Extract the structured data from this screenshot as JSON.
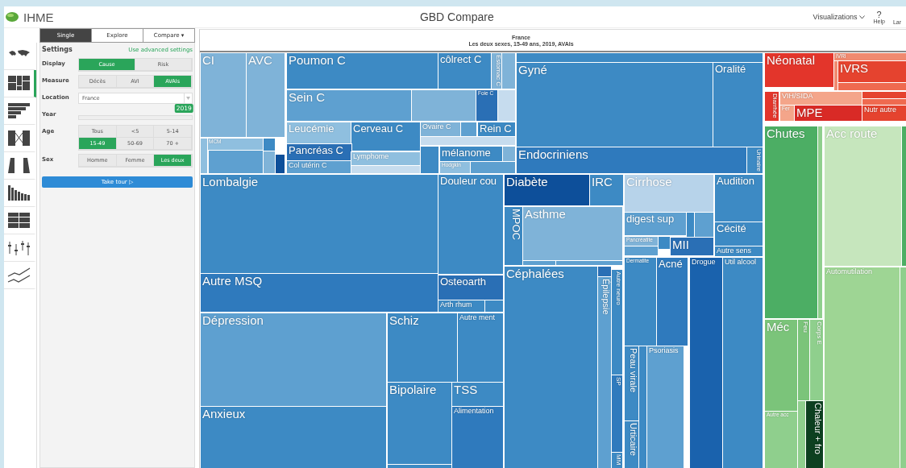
{
  "header": {
    "logo": "IHME",
    "title": "GBD Compare",
    "menu": "Visualizations",
    "help_icon": "?",
    "help": "Help",
    "language": "Lar"
  },
  "viz_icons": [
    {
      "kind": "map",
      "selected": false
    },
    {
      "kind": "treemap",
      "selected": true
    },
    {
      "kind": "stacked",
      "selected": false
    },
    {
      "kind": "arrows",
      "selected": false
    },
    {
      "kind": "pyramid",
      "selected": false
    },
    {
      "kind": "ranked",
      "selected": false
    },
    {
      "kind": "grid",
      "selected": false
    },
    {
      "kind": "whisker",
      "selected": false
    },
    {
      "kind": "line",
      "selected": false
    }
  ],
  "mode_tabs": [
    {
      "label": "Single",
      "selected": true
    },
    {
      "label": "Explore",
      "selected": false
    },
    {
      "label": "Compare ▾",
      "selected": false
    }
  ],
  "settings": {
    "title": "Settings",
    "advanced_link": "Use advanced settings",
    "display": {
      "label": "Display",
      "options": [
        {
          "label": "Cause",
          "selected": true
        },
        {
          "label": "Risk",
          "selected": false
        }
      ]
    },
    "measure": {
      "label": "Measure",
      "options": [
        {
          "label": "Décès",
          "selected": false
        },
        {
          "label": "AVI",
          "selected": false
        },
        {
          "label": "AVAIs",
          "selected": true
        }
      ]
    },
    "location": {
      "label": "Location",
      "value": "France"
    },
    "year": {
      "label": "Year",
      "value": "2019",
      "level": 1.0
    },
    "age": {
      "label": "Age",
      "options": [
        {
          "label": "Tous",
          "selected": false
        },
        {
          "label": "<5",
          "selected": false
        },
        {
          "label": "5-14",
          "selected": false
        },
        {
          "label": "15-49",
          "selected": true
        },
        {
          "label": "50-69",
          "selected": false
        },
        {
          "label": "70 +",
          "selected": false
        }
      ]
    },
    "sex": {
      "label": "Sex",
      "options": [
        {
          "label": "Homme",
          "selected": false
        },
        {
          "label": "Femme",
          "selected": false
        },
        {
          "label": "Les deux",
          "selected": true
        }
      ]
    },
    "tour_button": "Take tour ▷"
  },
  "treemap": {
    "title": "France",
    "subtitle": "Les deux sexes, 15-49 ans, 2019, AVAIs",
    "tiles": [
      {
        "label": "CI",
        "color": "#7fb3d8",
        "kind": "large"
      },
      {
        "label": "AVC",
        "color": "#7fb3d8",
        "kind": "large"
      },
      {
        "label": "MCM",
        "color": "#8fbfdf",
        "kind": "tiny"
      },
      {
        "color": "#5ea0d0",
        "kind": "blank"
      },
      {
        "color": "#3d8ac4",
        "kind": "blank"
      },
      {
        "color": "#7fb3d8",
        "kind": "blank"
      },
      {
        "color": "#0d4f9a",
        "kind": "blank"
      },
      {
        "color": "#8fbfdf",
        "kind": "blank"
      },
      {
        "label": "Poumon C",
        "color": "#3d8ac4",
        "kind": "large"
      },
      {
        "label": "côlrect C",
        "color": "#3d8ac4",
        "kind": "medium"
      },
      {
        "label": "Estomac C",
        "color": "#7fb3d8",
        "kind": "v-tiny"
      },
      {
        "color": "#7fb3d8",
        "kind": "blank"
      },
      {
        "label": "Sein C",
        "color": "#5ea0d0",
        "kind": "large"
      },
      {
        "color": "#7fb3d8",
        "kind": "blank"
      },
      {
        "label": "Foie C",
        "color": "#2a6fb5",
        "kind": "tiny"
      },
      {
        "color": "#c6dcee",
        "kind": "blank"
      },
      {
        "label": "Leucémie",
        "color": "#8fbfdf",
        "kind": "medium"
      },
      {
        "label": "Cerveau C",
        "color": "#3d8ac4",
        "kind": "medium"
      },
      {
        "label": "Ovaire C",
        "color": "#7fb3d8",
        "kind": "small"
      },
      {
        "color": "#5ea0d0",
        "kind": "blank"
      },
      {
        "label": "Rein C",
        "color": "#3d8ac4",
        "kind": "medium"
      },
      {
        "label": "Pancréas C",
        "color": "#2a6fb5",
        "kind": "medium"
      },
      {
        "label": "Col utérin C",
        "color": "#5ea0d0",
        "kind": "small"
      },
      {
        "label": "Lymphome",
        "color": "#8fbfdf",
        "kind": "small"
      },
      {
        "color": "#c6dcee",
        "kind": "blank"
      },
      {
        "color": "#c6dcee",
        "kind": "blank"
      },
      {
        "color": "#3d8ac4",
        "kind": "blank"
      },
      {
        "label": "mélanome",
        "color": "#3d8ac4",
        "kind": "medium"
      },
      {
        "label": "Hodgkin",
        "color": "#8fbfdf",
        "kind": "tiny"
      },
      {
        "color": "#5ea0d0",
        "kind": "blank"
      },
      {
        "color": "#7fb3d8",
        "kind": "blank"
      },
      {
        "color": "#3d8ac4",
        "kind": "blank"
      },
      {
        "label": "Gyné",
        "color": "#3d8ac4",
        "kind": "large"
      },
      {
        "label": "Oralité",
        "color": "#3d8ac4",
        "kind": "medium"
      },
      {
        "label": "Endocriniens",
        "color": "#2f7abd",
        "kind": "large"
      },
      {
        "label": "Urinaire",
        "color": "#3d8ac4",
        "kind": "v-tiny"
      },
      {
        "label": "Lombalgie",
        "color": "#3d8ac4",
        "kind": "large"
      },
      {
        "label": "Douleur cou",
        "color": "#3d8ac4",
        "kind": "medium"
      },
      {
        "label": "Autre MSQ",
        "color": "#2f7abd",
        "kind": "large"
      },
      {
        "label": "Osteoarth",
        "color": "#2a6fb5",
        "kind": "medium"
      },
      {
        "label": "Arth rhum",
        "color": "#3d8ac4",
        "kind": "small"
      },
      {
        "color": "#3d8ac4",
        "kind": "blank"
      },
      {
        "label": "Dépression",
        "color": "#5ea0d0",
        "kind": "large"
      },
      {
        "label": "Anxieux",
        "color": "#3d8ac4",
        "kind": "large"
      },
      {
        "label": "Schiz",
        "color": "#3d8ac4",
        "kind": "large"
      },
      {
        "label": "Autre ment",
        "color": "#3d8ac4",
        "kind": "small"
      },
      {
        "label": "Bipolaire",
        "color": "#3d8ac4",
        "kind": "large"
      },
      {
        "color": "#3d8ac4",
        "kind": "blank"
      },
      {
        "label": "TSS",
        "color": "#3d8ac4",
        "kind": "large"
      },
      {
        "label": "Alimentation",
        "color": "#2f7abd",
        "kind": "small"
      },
      {
        "label": "Diabète",
        "color": "#0d4f9a",
        "kind": "large"
      },
      {
        "label": "IRC",
        "color": "#3d8ac4",
        "kind": "large"
      },
      {
        "label": "MPOC",
        "color": "#3d8ac4",
        "kind": "v-large"
      },
      {
        "label": "Asthme",
        "color": "#7fb3d8",
        "kind": "large"
      },
      {
        "color": "#5ea0d0",
        "kind": "blank"
      },
      {
        "color": "#5ea0d0",
        "kind": "blank"
      },
      {
        "label": "Céphalées",
        "color": "#3d8ac4",
        "kind": "large"
      },
      {
        "color": "#2a6fb5",
        "kind": "blank"
      },
      {
        "label": "Épilepsie",
        "color": "#5ea0d0",
        "kind": "v-medium"
      },
      {
        "label": "Autre neuro",
        "color": "#3d8ac4",
        "kind": "v-small"
      },
      {
        "label": "SP",
        "color": "#2f7abd",
        "kind": "v-small"
      },
      {
        "label": "MM",
        "color": "#3d8ac4",
        "kind": "v-tiny"
      },
      {
        "label": "Cirrhose",
        "color": "#b7d3ea",
        "kind": "large"
      },
      {
        "label": "digest sup",
        "color": "#5ea0d0",
        "kind": "medium"
      },
      {
        "color": "#3d8ac4",
        "kind": "blank"
      },
      {
        "color": "#5ea0d0",
        "kind": "blank"
      },
      {
        "label": "Pancréatite",
        "color": "#7fb3d8",
        "kind": "tiny"
      },
      {
        "color": "#3d8ac4",
        "kind": "blank"
      },
      {
        "label": "MII",
        "color": "#2a6fb5",
        "kind": "large"
      },
      {
        "color": "#5ea0d0",
        "kind": "blank"
      },
      {
        "label": "Audition",
        "color": "#3d8ac4",
        "kind": "medium"
      },
      {
        "label": "Cécité",
        "color": "#3d8ac4",
        "kind": "medium"
      },
      {
        "label": "Autre sens",
        "color": "#3d8ac4",
        "kind": "small"
      },
      {
        "label": "Dermatite",
        "color": "#3d8ac4",
        "kind": "tiny"
      },
      {
        "label": "Acné",
        "color": "#2f7abd",
        "kind": "medium"
      },
      {
        "label": "Peau virale",
        "color": "#3d8ac4",
        "kind": "v-medium"
      },
      {
        "label": "Urticaire",
        "color": "#3d8ac4",
        "kind": "v-medium"
      },
      {
        "color": "#3d8ac4",
        "kind": "blank"
      },
      {
        "label": "Psoriasis",
        "color": "#5ea0d0",
        "kind": "small"
      },
      {
        "label": "Drogue",
        "color": "#1a62ad",
        "kind": "small"
      },
      {
        "label": "Util alcool",
        "color": "#3d8ac4",
        "kind": "small"
      },
      {
        "label": "Néonatal",
        "color": "#e3352b",
        "kind": "large"
      },
      {
        "label": "IVRI",
        "color": "#f08a70",
        "kind": "tiny"
      },
      {
        "color": "#f08a70",
        "kind": "blank"
      },
      {
        "label": "IVRS",
        "color": "#e5432f",
        "kind": "large"
      },
      {
        "color": "#ef6a50",
        "kind": "blank"
      },
      {
        "label": "Diarrhée",
        "color": "#e3352b",
        "kind": "v-tiny"
      },
      {
        "label": "VIH/SIDA",
        "color": "#f4a58a",
        "kind": "small"
      },
      {
        "color": "#e5432f",
        "kind": "blank"
      },
      {
        "color": "#ef6a50",
        "kind": "blank"
      },
      {
        "label": "Fer",
        "color": "#f4a58a",
        "kind": "tiny"
      },
      {
        "label": "MPE",
        "color": "#d92a26",
        "kind": "large"
      },
      {
        "label": "Nutr autre",
        "color": "#e5432f",
        "kind": "small"
      },
      {
        "label": "Chutes",
        "color": "#4cae64",
        "kind": "large"
      },
      {
        "color": "#8fcf8d",
        "kind": "blank"
      },
      {
        "label": "Acc route",
        "color": "#c6e6bd",
        "kind": "large"
      },
      {
        "color": "#4cae64",
        "kind": "blank"
      },
      {
        "label": "Automutilation",
        "color": "#9ed594",
        "kind": "small"
      },
      {
        "color": "#8fcf8d",
        "kind": "blank"
      },
      {
        "label": "Méc",
        "color": "#7bc47a",
        "kind": "large"
      },
      {
        "label": "Feu",
        "color": "#7bc47a",
        "kind": "v-small"
      },
      {
        "label": "Corps E",
        "color": "#8fcf8d",
        "kind": "v-small"
      },
      {
        "label": "Autre acc",
        "color": "#8fcf8d",
        "kind": "tiny"
      },
      {
        "color": "#8fcf8d",
        "kind": "blank"
      },
      {
        "label": "Chaleur + fro",
        "color": "#0d4020",
        "kind": "v-medium"
      }
    ]
  }
}
